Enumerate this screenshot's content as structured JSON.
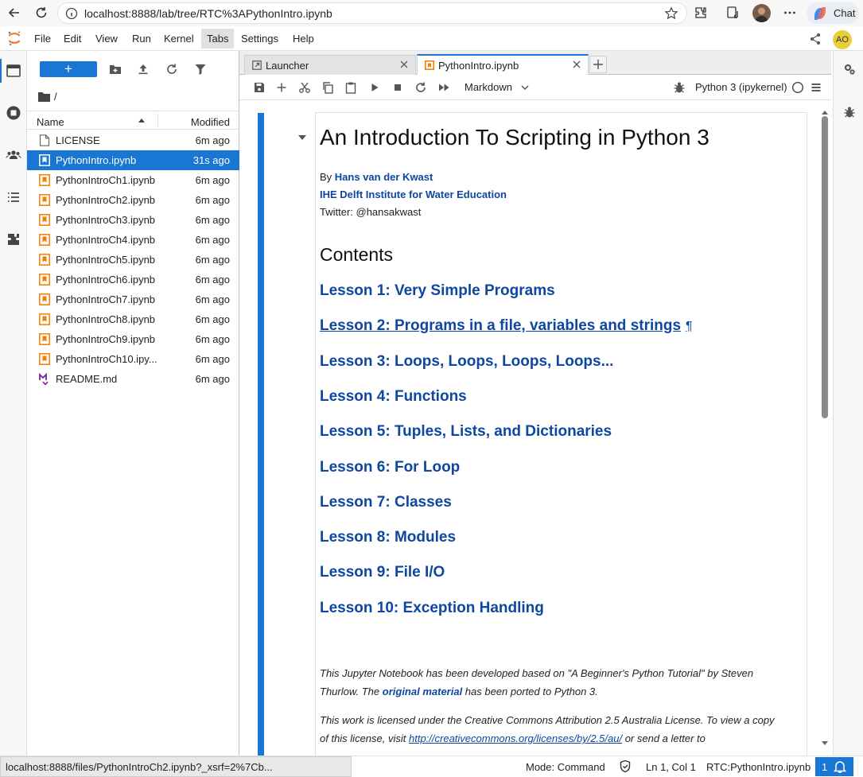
{
  "browser": {
    "url": "localhost:8888/lab/tree/RTC%3APythonIntro.ipynb",
    "chat_label": "Chat"
  },
  "menu": {
    "items": [
      "File",
      "Edit",
      "View",
      "Run",
      "Kernel",
      "Tabs",
      "Settings",
      "Help"
    ],
    "active": "Tabs",
    "user_initials": "AO"
  },
  "filebrowser": {
    "new_label": "+",
    "breadcrumb": "/",
    "col_name": "Name",
    "col_modified": "Modified",
    "files": [
      {
        "name": "LICENSE",
        "modified": "6m ago",
        "type": "file"
      },
      {
        "name": "PythonIntro.ipynb",
        "modified": "31s ago",
        "type": "notebook",
        "selected": true
      },
      {
        "name": "PythonIntroCh1.ipynb",
        "modified": "6m ago",
        "type": "notebook"
      },
      {
        "name": "PythonIntroCh2.ipynb",
        "modified": "6m ago",
        "type": "notebook"
      },
      {
        "name": "PythonIntroCh3.ipynb",
        "modified": "6m ago",
        "type": "notebook"
      },
      {
        "name": "PythonIntroCh4.ipynb",
        "modified": "6m ago",
        "type": "notebook"
      },
      {
        "name": "PythonIntroCh5.ipynb",
        "modified": "6m ago",
        "type": "notebook"
      },
      {
        "name": "PythonIntroCh6.ipynb",
        "modified": "6m ago",
        "type": "notebook"
      },
      {
        "name": "PythonIntroCh7.ipynb",
        "modified": "6m ago",
        "type": "notebook"
      },
      {
        "name": "PythonIntroCh8.ipynb",
        "modified": "6m ago",
        "type": "notebook"
      },
      {
        "name": "PythonIntroCh9.ipynb",
        "modified": "6m ago",
        "type": "notebook"
      },
      {
        "name": "PythonIntroCh10.ipy...",
        "modified": "6m ago",
        "type": "notebook"
      },
      {
        "name": "README.md",
        "modified": "6m ago",
        "type": "markdown"
      }
    ]
  },
  "tabs": [
    {
      "label": "Launcher",
      "active": false
    },
    {
      "label": "PythonIntro.ipynb",
      "active": true
    }
  ],
  "toolbar": {
    "cell_type": "Markdown",
    "kernel": "Python 3 (ipykernel)"
  },
  "notebook": {
    "title": "An Introduction To Scripting in Python 3",
    "by_prefix": "By ",
    "author": "Hans van der Kwast",
    "institute": "IHE Delft Institute for Water Education",
    "twitter": "Twitter: @hansakwast",
    "contents_heading": "Contents",
    "pilcrow": "¶",
    "lessons": [
      "Lesson 1: Very Simple Programs",
      "Lesson 2: Programs in a file, variables and strings",
      "Lesson 3: Loops, Loops, Loops, Loops...",
      "Lesson 4: Functions",
      "Lesson 5: Tuples, Lists, and Dictionaries",
      "Lesson 6: For Loop",
      "Lesson 7: Classes",
      "Lesson 8: Modules",
      "Lesson 9: File I/O",
      "Lesson 10: Exception Handling"
    ],
    "para1_a": "This Jupyter Notebook has been developed based on \"A Beginner's Python Tutorial\" by Steven Thurlow. The ",
    "para1_link": "original material",
    "para1_b": " has been ported to Python 3.",
    "para2_a": "This work is licensed under the Creative Commons Attribution 2.5 Australia License. To view a copy of this license, visit ",
    "para2_link": "http://creativecommons.org/licenses/by/2.5/au/",
    "para2_b": " or send a letter to"
  },
  "statusbar": {
    "link_preview": "localhost:8888/files/PythonIntroCh2.ipynb?_xsrf=2%7Cb...",
    "mode": "Mode: Command",
    "position": "Ln 1, Col 1",
    "doc": "RTC:PythonIntro.ipynb",
    "notifications": "1"
  },
  "colors": {
    "accent": "#1976d2",
    "link": "#0d47a1",
    "notebook_icon": "#f57c00"
  }
}
